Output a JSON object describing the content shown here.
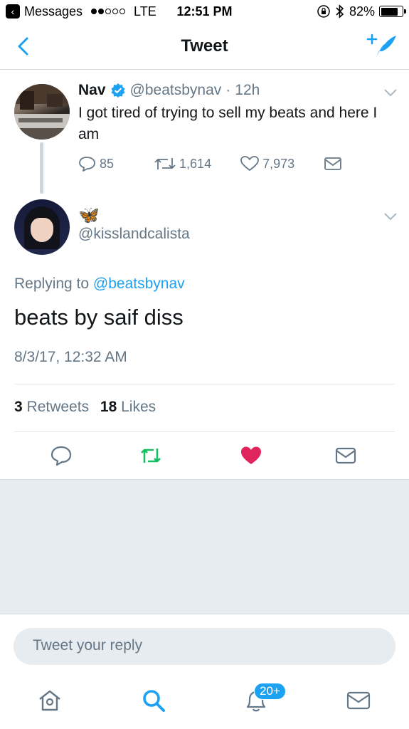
{
  "status_bar": {
    "back_app": "Messages",
    "carrier": "LTE",
    "time": "12:51 PM",
    "battery": "82%",
    "battery_level": 0.82
  },
  "nav": {
    "title": "Tweet"
  },
  "parent_tweet": {
    "name": "Nav",
    "handle": "@beatsbynav",
    "age": "12h",
    "text": "I got tired of trying to sell my beats and here I am",
    "replies": "85",
    "retweets": "1,614",
    "likes": "7,973"
  },
  "main_tweet": {
    "name_emoji": "🦋",
    "handle": "@kisslandcalista",
    "replying_label": "Replying to",
    "replying_handle": "@beatsbynav",
    "text": "beats by saif diss",
    "date": "8/3/17, 12:32 AM",
    "retweet_count": "3",
    "retweet_label": "Retweets",
    "like_count": "18",
    "like_label": "Likes"
  },
  "reply": {
    "placeholder": "Tweet your reply"
  },
  "tab_bar": {
    "notifications_badge": "20+"
  },
  "colors": {
    "accent": "#1da1f2",
    "retweet": "#17bf63",
    "like": "#e0245e",
    "muted": "#657786"
  },
  "icons": [
    "back-arrow-icon",
    "compose-icon",
    "verified-icon",
    "reply-icon",
    "retweet-icon",
    "heart-icon",
    "message-icon",
    "home-icon",
    "search-icon",
    "bell-icon",
    "mail-icon"
  ]
}
